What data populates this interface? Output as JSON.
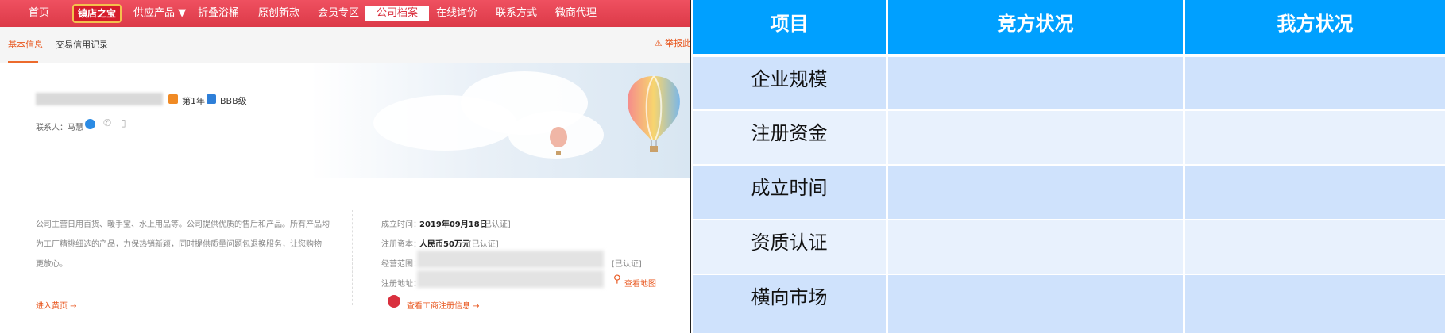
{
  "nav": {
    "items": [
      "首页",
      "镇店之宝",
      "供应产品 ▼",
      "折叠浴桶",
      "原创新款",
      "会员专区",
      "公司档案",
      "在线询价",
      "联系方式",
      "微商代理"
    ],
    "active": "公司档案"
  },
  "tabs": {
    "basic": "基本信息",
    "credit": "交易信用记录",
    "report": "举报此"
  },
  "profile": {
    "year_badge": "第1年",
    "rating": "BBB级",
    "contact_label": "联系人：马慧"
  },
  "info": {
    "desc_lines": [
      "公司主营日用百货、暖手宝、水上用品等。公司提供优质的售后和产品。所有产品均",
      "为工厂精挑细选的产品，力保热销新颖，同时提供质量问题包退换服务，让您购物",
      "更放心。"
    ],
    "enter_shop": "进入黄页 →",
    "founded_label": "成立时间：",
    "founded_value": "2019年09月18日",
    "verified": "[已认证]",
    "capital_label": "注册资本：",
    "capital_value": "人民币50万元",
    "scope_label": "经营范围：",
    "address_label": "注册地址：",
    "view_map": "查看地图",
    "registry_link": "查看工商注册信息 →"
  },
  "table": {
    "headers": [
      "项目",
      "竞方状况",
      "我方状况"
    ],
    "rows": [
      "企业规模",
      "注册资金",
      "成立时间",
      "资质认证",
      "横向市场"
    ],
    "colors": {
      "header": "#00a0ff",
      "row_a": "#cfe2fc",
      "row_b": "#e8f1fd"
    }
  }
}
